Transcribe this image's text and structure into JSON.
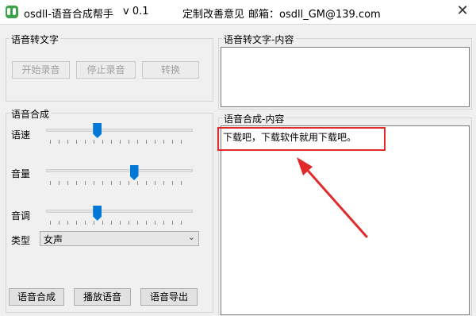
{
  "window": {
    "title": "osdll-语音合成帮手",
    "version": "v 0.1",
    "feedback": "定制改善意见",
    "email": "邮箱：osdll_GM@139.com",
    "close_glyph": "✕"
  },
  "speech_to_text": {
    "group_title": "语音转文字",
    "start_label": "开始录音",
    "stop_label": "停止录音",
    "convert_label": "转换"
  },
  "speech_to_text_content": {
    "group_title": "语音转文字-内容",
    "value": ""
  },
  "synthesis": {
    "group_title": "语音合成",
    "speed_label": "语速",
    "speed_level": 0.35,
    "volume_label": "音量",
    "volume_level": 0.6,
    "pitch_label": "音调",
    "pitch_level": 0.35,
    "type_label": "类型",
    "type_value": "女声",
    "synthesize_label": "语音合成",
    "play_label": "播放语音",
    "export_label": "语音导出"
  },
  "synthesis_content": {
    "group_title": "语音合成-内容",
    "value": "下载吧，下载软件就用下载吧。"
  },
  "annotation": {
    "color": "#e12b2b"
  },
  "icons": {
    "app": "app-logo-icon",
    "combo": "chevron-down-icon"
  }
}
